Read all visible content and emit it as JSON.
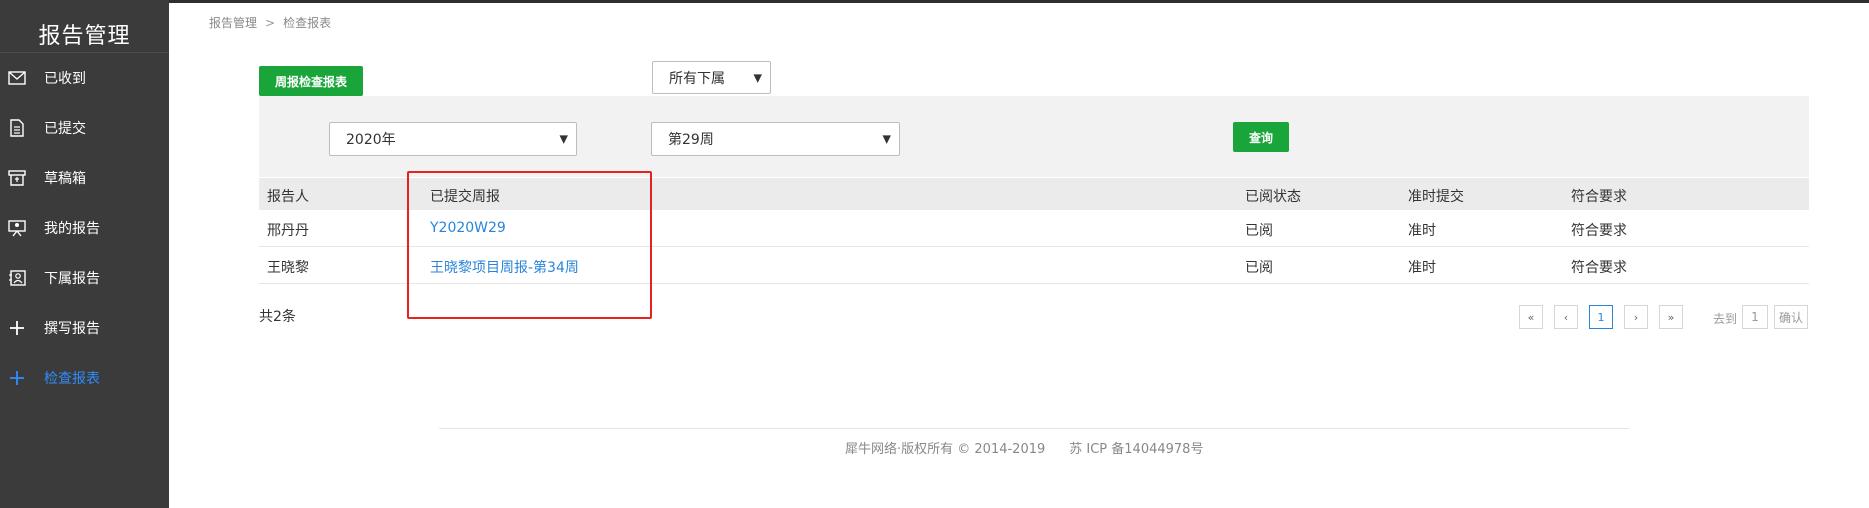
{
  "sidebar": {
    "title": "报告管理",
    "items": [
      {
        "label": "已收到",
        "icon": "envelope-icon"
      },
      {
        "label": "已提交",
        "icon": "document-icon"
      },
      {
        "label": "草稿箱",
        "icon": "drafts-icon"
      },
      {
        "label": "我的报告",
        "icon": "presentation-icon"
      },
      {
        "label": "下属报告",
        "icon": "contact-card-icon"
      },
      {
        "label": "撰写报告",
        "icon": "plus-icon"
      },
      {
        "label": "检查报表",
        "icon": "plus-icon"
      }
    ],
    "active_index": 6,
    "active_color": "#2f8cff"
  },
  "breadcrumb": {
    "root": "报告管理",
    "separator": ">",
    "current": "检查报表"
  },
  "toolbar": {
    "weekly_report_button": "周报检查报表",
    "subordinate_select": "所有下属"
  },
  "filters": {
    "year_select": "2020年",
    "week_select": "第29周",
    "query_button": "查询"
  },
  "table": {
    "headers": [
      "报告人",
      "已提交周报",
      "已阅状态",
      "准时提交",
      "符合要求"
    ],
    "rows": [
      {
        "reporter": "邢丹丹",
        "report": "Y2020W29",
        "read_status": "已阅",
        "on_time": "准时",
        "compliance": "符合要求"
      },
      {
        "reporter": "王晓黎",
        "report": "王晓黎项目周报-第34周",
        "read_status": "已阅",
        "on_time": "准时",
        "compliance": "符合要求"
      }
    ]
  },
  "summary": {
    "total": "共2条"
  },
  "pagination": {
    "first": "«",
    "prev": "‹",
    "current_page": "1",
    "next": "›",
    "last": "»",
    "goto_label": "去到",
    "goto_value": "1",
    "confirm": "确认"
  },
  "footer": {
    "copyright": "犀牛网络·版权所有 © 2014-2019",
    "icp": "苏 ICP 备14044978号"
  },
  "colors": {
    "accent_green": "#19a53a",
    "link_blue": "#2a85d9",
    "highlight_red": "#e52222",
    "sidebar_bg": "#3b3b3b"
  }
}
